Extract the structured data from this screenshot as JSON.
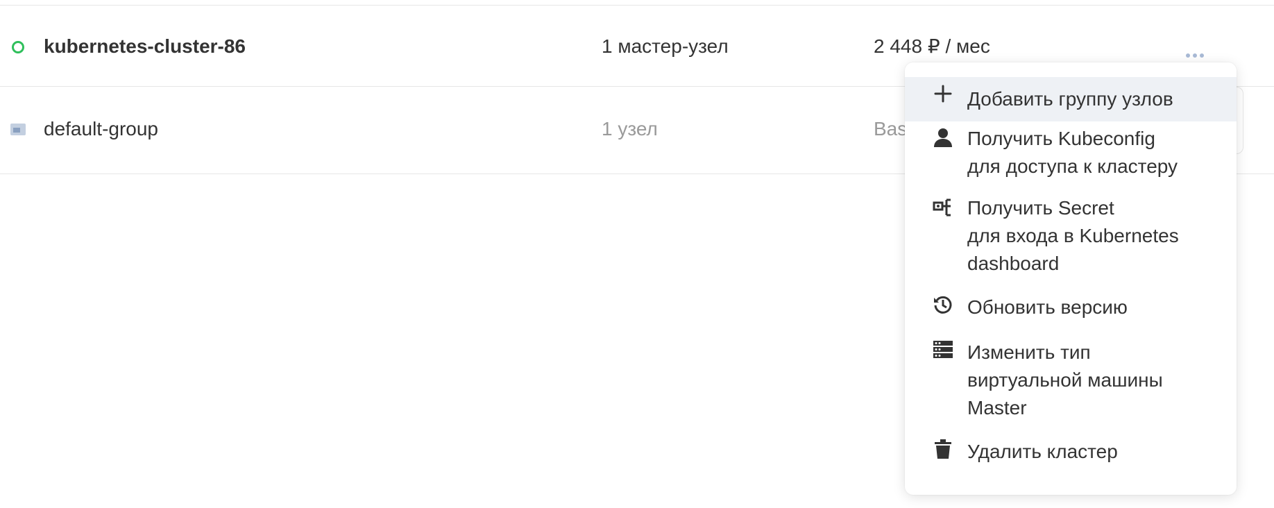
{
  "cluster": {
    "name": "kubernetes-cluster-86",
    "nodes": "1 мастер-узел",
    "price": "2 448 ₽ / мес",
    "status_color": "#2fbf5b"
  },
  "node_group": {
    "name": "default-group",
    "nodes": "1 узел",
    "type_partial": "Bas"
  },
  "menu": {
    "items": [
      {
        "icon": "plus-icon",
        "lines": [
          "Добавить группу узлов"
        ],
        "highlighted": true
      },
      {
        "icon": "user-icon",
        "lines": [
          "Получить Kubeconfig",
          "для доступа к кластеру"
        ]
      },
      {
        "icon": "key-icon",
        "lines": [
          "Получить Secret",
          "для входа в Kubernetes",
          "dashboard"
        ]
      },
      {
        "icon": "history-icon",
        "lines": [
          "Обновить версию"
        ]
      },
      {
        "icon": "server-icon",
        "lines": [
          "Изменить тип",
          "виртуальной машины",
          "Master"
        ]
      },
      {
        "icon": "trash-icon",
        "lines": [
          "Удалить кластер"
        ]
      }
    ]
  }
}
